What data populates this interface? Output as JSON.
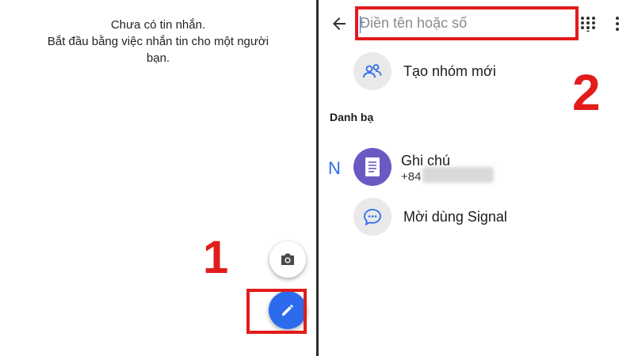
{
  "left_panel": {
    "empty_title": "Chưa có tin nhắn.",
    "empty_subtitle": "Bắt đầu bằng việc nhắn tin cho một người bạn.",
    "step_label": "1",
    "camera_icon": "camera-icon",
    "compose_icon": "pencil-icon",
    "accent_color": "#2c6bed"
  },
  "right_panel": {
    "search": {
      "placeholder": "Điền tên hoặc số",
      "value": ""
    },
    "new_group_label": "Tạo nhóm mới",
    "contacts_header": "Danh bạ",
    "index_letter": "N",
    "contact": {
      "name": "Ghi chú",
      "phone": "+84"
    },
    "invite_label": "Mời dùng Signal",
    "step_label": "2"
  },
  "highlight_color": "#e21b1b"
}
